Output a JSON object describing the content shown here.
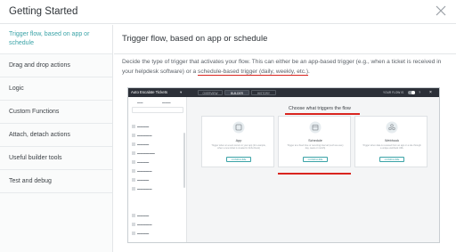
{
  "modal": {
    "title": "Getting Started"
  },
  "sidebar": {
    "items": [
      {
        "label": "Trigger flow, based on app or schedule"
      },
      {
        "label": "Drag and drop actions"
      },
      {
        "label": "Logic"
      },
      {
        "label": "Custom Functions"
      },
      {
        "label": "Attach, detach actions"
      },
      {
        "label": "Useful builder tools"
      },
      {
        "label": "Test and debug"
      }
    ]
  },
  "main": {
    "title": "Trigger flow, based on app or schedule",
    "description_pre": "Decide the type of trigger that activates your flow. This can either be an app-based trigger (e.g., when a ticket is received in your helpdesk software) or a ",
    "description_underlined": "schedule-based trigger (daily, weekly, etc.)",
    "description_post": "."
  },
  "screenshot": {
    "app_title": "Auto Escalate Tickets",
    "tabs": [
      "OVERVIEW",
      "BUILDER",
      "HISTORY"
    ],
    "active_tab": "BUILDER",
    "flow_label": "YOUR FLOW IS",
    "canvas_title": "Choose what triggers the flow",
    "cards": [
      {
        "title": "App",
        "desc": "Trigger when an event occurs in your app (for example, when a new ticket is created in Zoho Desk)",
        "button": "CONFIGURE",
        "highlighted": false
      },
      {
        "title": "Schedule",
        "desc": "Trigger at a fixed time or recurring interval (such as every day, week or month)",
        "button": "CONFIGURE",
        "highlighted": true
      },
      {
        "title": "Webhook",
        "desc": "Trigger when data is received from an app or a site through a unique webhook URL",
        "button": "CONFIGURE",
        "highlighted": false
      }
    ]
  },
  "colors": {
    "accent": "#3aa3a7",
    "highlight": "#d9251f",
    "topbar": "#2c3038"
  }
}
